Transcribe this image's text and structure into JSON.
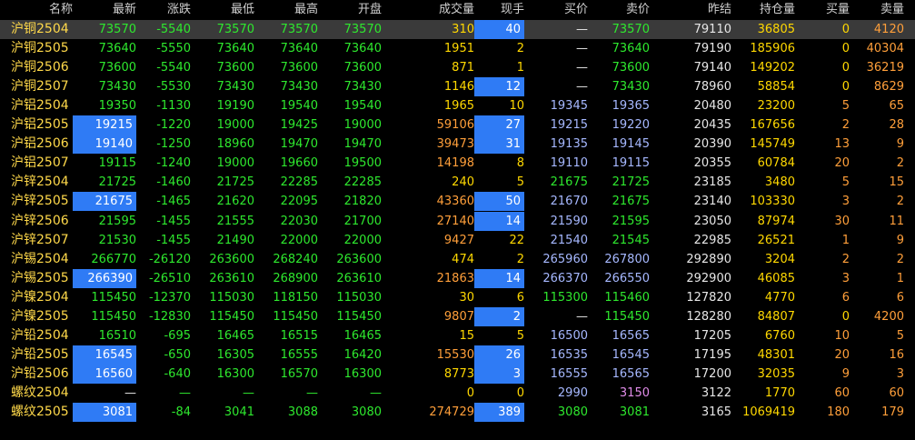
{
  "headers": [
    "名称",
    "最新",
    "涨跌",
    "最低",
    "最高",
    "开盘",
    "成交量",
    "现手",
    "买价",
    "卖价",
    "昨结",
    "持仓量",
    "买量",
    "卖量"
  ],
  "rows": [
    [
      "沪铜2504",
      "73570",
      "-5540",
      "73570",
      "73570",
      "73570",
      "310",
      "40",
      "—",
      "73570",
      "79110",
      "36805",
      "0",
      "4120"
    ],
    [
      "沪铜2505",
      "73640",
      "-5550",
      "73640",
      "73640",
      "73640",
      "1951",
      "2",
      "—",
      "73640",
      "79190",
      "185906",
      "0",
      "40304"
    ],
    [
      "沪铜2506",
      "73600",
      "-5540",
      "73600",
      "73600",
      "73600",
      "871",
      "1",
      "—",
      "73600",
      "79140",
      "149202",
      "0",
      "36219"
    ],
    [
      "沪铜2507",
      "73430",
      "-5530",
      "73430",
      "73430",
      "73430",
      "1146",
      "12",
      "—",
      "73430",
      "78960",
      "58854",
      "0",
      "8629"
    ],
    [
      "沪铝2504",
      "19350",
      "-1130",
      "19190",
      "19540",
      "19540",
      "1965",
      "10",
      "19345",
      "19365",
      "20480",
      "23200",
      "5",
      "65"
    ],
    [
      "沪铝2505",
      "19215",
      "-1220",
      "19000",
      "19425",
      "19000",
      "59106",
      "27",
      "19215",
      "19220",
      "20435",
      "167656",
      "2",
      "28"
    ],
    [
      "沪铝2506",
      "19140",
      "-1250",
      "18960",
      "19470",
      "19470",
      "39473",
      "31",
      "19135",
      "19145",
      "20390",
      "145749",
      "13",
      "9"
    ],
    [
      "沪铝2507",
      "19115",
      "-1240",
      "19000",
      "19660",
      "19500",
      "14198",
      "8",
      "19110",
      "19115",
      "20355",
      "60784",
      "20",
      "2"
    ],
    [
      "沪锌2504",
      "21725",
      "-1460",
      "21725",
      "22285",
      "22285",
      "240",
      "5",
      "21675",
      "21725",
      "23185",
      "3480",
      "5",
      "15"
    ],
    [
      "沪锌2505",
      "21675",
      "-1465",
      "21620",
      "22095",
      "21820",
      "43360",
      "50",
      "21670",
      "21675",
      "23140",
      "103330",
      "3",
      "2"
    ],
    [
      "沪锌2506",
      "21595",
      "-1455",
      "21555",
      "22030",
      "21700",
      "27140",
      "14",
      "21590",
      "21595",
      "23050",
      "87974",
      "30",
      "11"
    ],
    [
      "沪锌2507",
      "21530",
      "-1455",
      "21490",
      "22000",
      "22000",
      "9427",
      "22",
      "21540",
      "21545",
      "22985",
      "26521",
      "1",
      "9"
    ],
    [
      "沪锡2504",
      "266770",
      "-26120",
      "263600",
      "268240",
      "263600",
      "474",
      "2",
      "265960",
      "267800",
      "292890",
      "3204",
      "2",
      "2"
    ],
    [
      "沪锡2505",
      "266390",
      "-26510",
      "263610",
      "268900",
      "263610",
      "21863",
      "14",
      "266370",
      "266550",
      "292900",
      "46085",
      "3",
      "1"
    ],
    [
      "沪镍2504",
      "115450",
      "-12370",
      "115030",
      "118150",
      "115030",
      "30",
      "6",
      "115300",
      "115460",
      "127820",
      "4770",
      "6",
      "6"
    ],
    [
      "沪镍2505",
      "115450",
      "-12830",
      "115450",
      "115450",
      "115450",
      "9807",
      "2",
      "—",
      "115450",
      "128280",
      "84807",
      "0",
      "4200"
    ],
    [
      "沪铅2504",
      "16510",
      "-695",
      "16465",
      "16515",
      "16465",
      "15",
      "5",
      "16500",
      "16565",
      "17205",
      "6760",
      "10",
      "5"
    ],
    [
      "沪铅2505",
      "16545",
      "-650",
      "16305",
      "16555",
      "16420",
      "15530",
      "26",
      "16535",
      "16545",
      "17195",
      "48301",
      "20",
      "16"
    ],
    [
      "沪铅2506",
      "16560",
      "-640",
      "16300",
      "16570",
      "16300",
      "8773",
      "3",
      "16555",
      "16565",
      "17200",
      "32035",
      "9",
      "3"
    ],
    [
      "螺纹2504",
      "—",
      "—",
      "—",
      "—",
      "—",
      "0",
      "0",
      "2990",
      "3150",
      "3122",
      "1770",
      "60",
      "60"
    ],
    [
      "螺纹2505",
      "3081",
      "-84",
      "3041",
      "3088",
      "3080",
      "274729",
      "389",
      "3080",
      "3081",
      "3165",
      "1069419",
      "180",
      "179"
    ]
  ],
  "selected_row": 0,
  "highlight_latest": [
    5,
    6,
    9,
    13,
    17,
    18,
    20
  ],
  "highlight_hand": [
    0,
    3,
    5,
    6,
    9,
    10,
    13,
    15,
    17,
    18,
    20
  ],
  "colors": {
    "bg": "#000000",
    "highlight": "#2f7bf5",
    "selected": "#3a3a3a",
    "green": "#2ee82e",
    "yellow": "#ffd800",
    "orange": "#ff9f3a",
    "blue": "#a6b8ff",
    "purple": "#e08ce8",
    "white": "#e6e6e6",
    "name": "#ffd94a"
  }
}
